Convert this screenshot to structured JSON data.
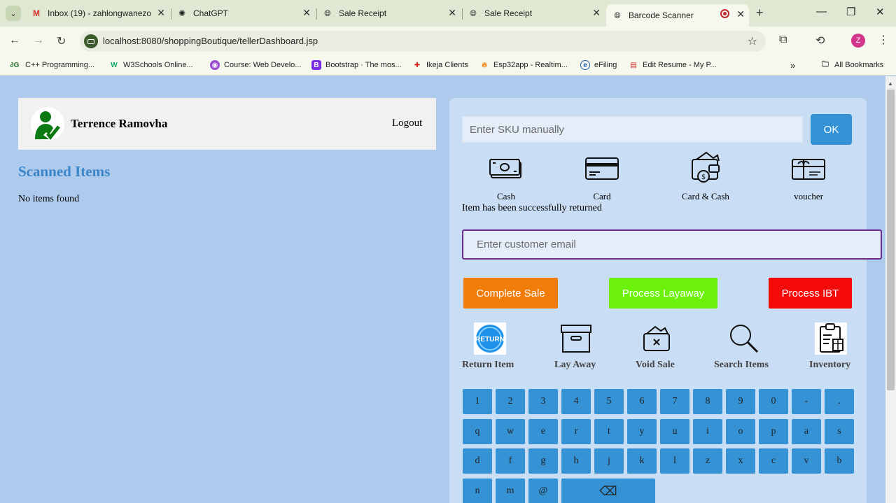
{
  "browser": {
    "tabs": [
      {
        "title": "Inbox (19) - zahlongwanezo",
        "favicon": "gmail-icon"
      },
      {
        "title": "ChatGPT",
        "favicon": "chatgpt-icon"
      },
      {
        "title": "Sale Receipt",
        "favicon": "globe-icon"
      },
      {
        "title": "Sale Receipt",
        "favicon": "globe-icon"
      },
      {
        "title": "Barcode Scanner",
        "favicon": "globe-icon"
      }
    ],
    "url": "localhost:8080/shoppingBoutique/tellerDashboard.jsp",
    "profile_initial": "Z",
    "bookmarks": [
      {
        "label": "C++ Programming..."
      },
      {
        "label": "W3Schools Online..."
      },
      {
        "label": "Course: Web Develo..."
      },
      {
        "label": "Bootstrap · The mos..."
      },
      {
        "label": "Ikeja Clients"
      },
      {
        "label": "Esp32app - Realtim..."
      },
      {
        "label": "eFiling"
      },
      {
        "label": "Edit Resume - My P..."
      }
    ],
    "all_bookmarks": "All Bookmarks"
  },
  "header": {
    "user_name": "Terrence Ramovha",
    "logout": "Logout"
  },
  "scanned": {
    "title": "Scanned Items",
    "empty": "No items found"
  },
  "checkout": {
    "sku_placeholder": "Enter SKU manually",
    "ok": "OK",
    "payments": [
      "Cash",
      "Card",
      "Card & Cash",
      "voucher"
    ],
    "status_message": "Item has been successfully returned",
    "email_placeholder": "Enter customer email",
    "actions": [
      {
        "label": "Complete Sale",
        "color": "#f07d0a"
      },
      {
        "label": "Process Layaway",
        "color": "#6bf10a"
      },
      {
        "label": "Process IBT",
        "color": "#f50a0a"
      }
    ],
    "tools": [
      "Return Item",
      "Lay Away",
      "Void Sale",
      "Search Items",
      "Inventory"
    ],
    "return_badge": "RETURN"
  },
  "keypad": {
    "row1": [
      "1",
      "2",
      "3",
      "4",
      "5",
      "6",
      "7",
      "8",
      "9",
      "0",
      "-",
      "."
    ],
    "row2": [
      "q",
      "w",
      "e",
      "r",
      "t",
      "y",
      "u",
      "i",
      "o",
      "p",
      "a",
      "s"
    ],
    "row3": [
      "d",
      "f",
      "g",
      "h",
      "j",
      "k",
      "l",
      "z",
      "x",
      "c",
      "v",
      "b"
    ],
    "row4": [
      "n",
      "m",
      "@"
    ],
    "backspace": "⌫"
  }
}
